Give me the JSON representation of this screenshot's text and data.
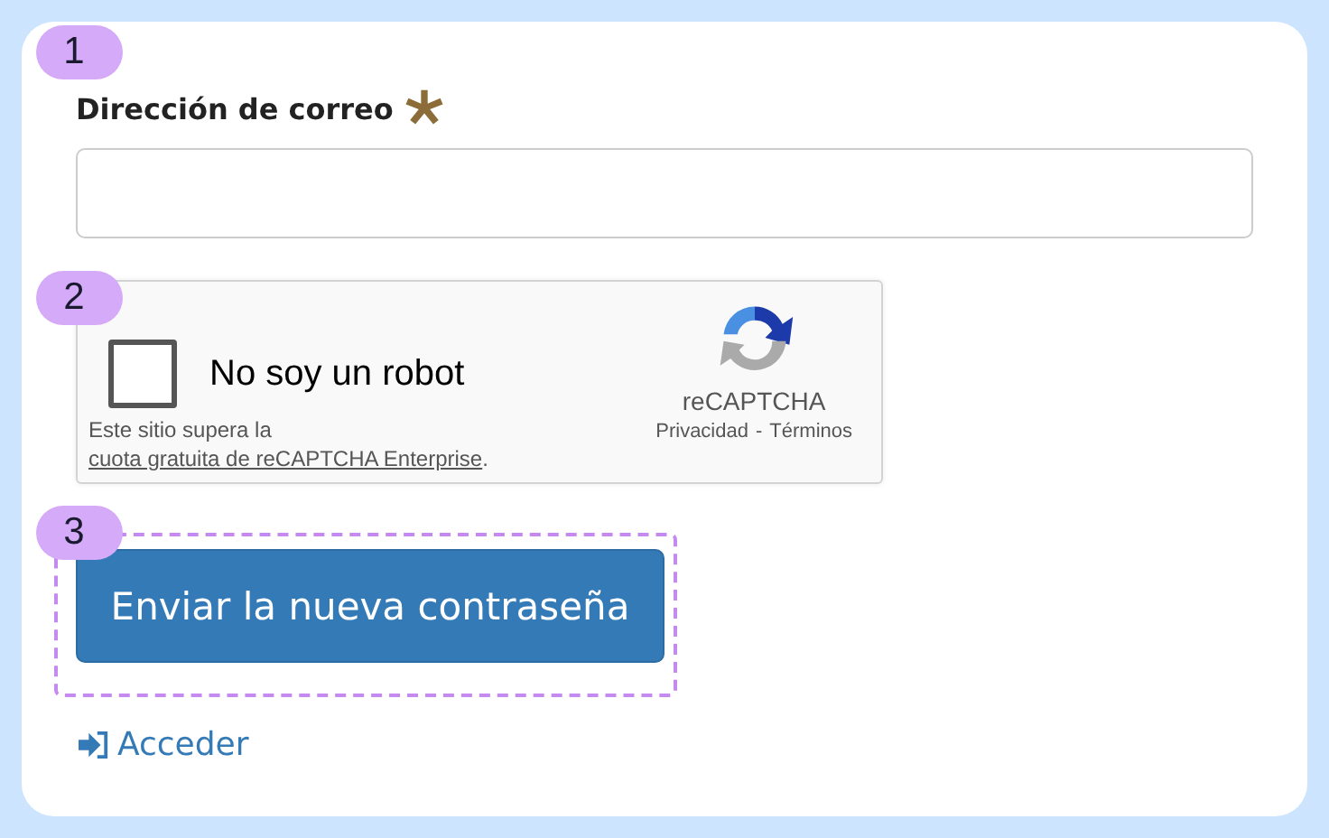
{
  "steps": [
    {
      "number": "1"
    },
    {
      "number": "2"
    },
    {
      "number": "3"
    }
  ],
  "email": {
    "label": "Dirección de correo",
    "required": true
  },
  "captcha": {
    "checked": false,
    "label": "No soy un robot",
    "brand": "reCAPTCHA",
    "privacy": "Privacidad",
    "separator": "-",
    "terms": "Términos",
    "notice_before": "Este sitio supera la ",
    "notice_link": "cuota gratuita de reCAPTCHA Enterprise",
    "notice_after": "."
  },
  "submit": {
    "label": "Enviar la nueva contraseña"
  },
  "login_link": {
    "label": "Acceder"
  }
}
